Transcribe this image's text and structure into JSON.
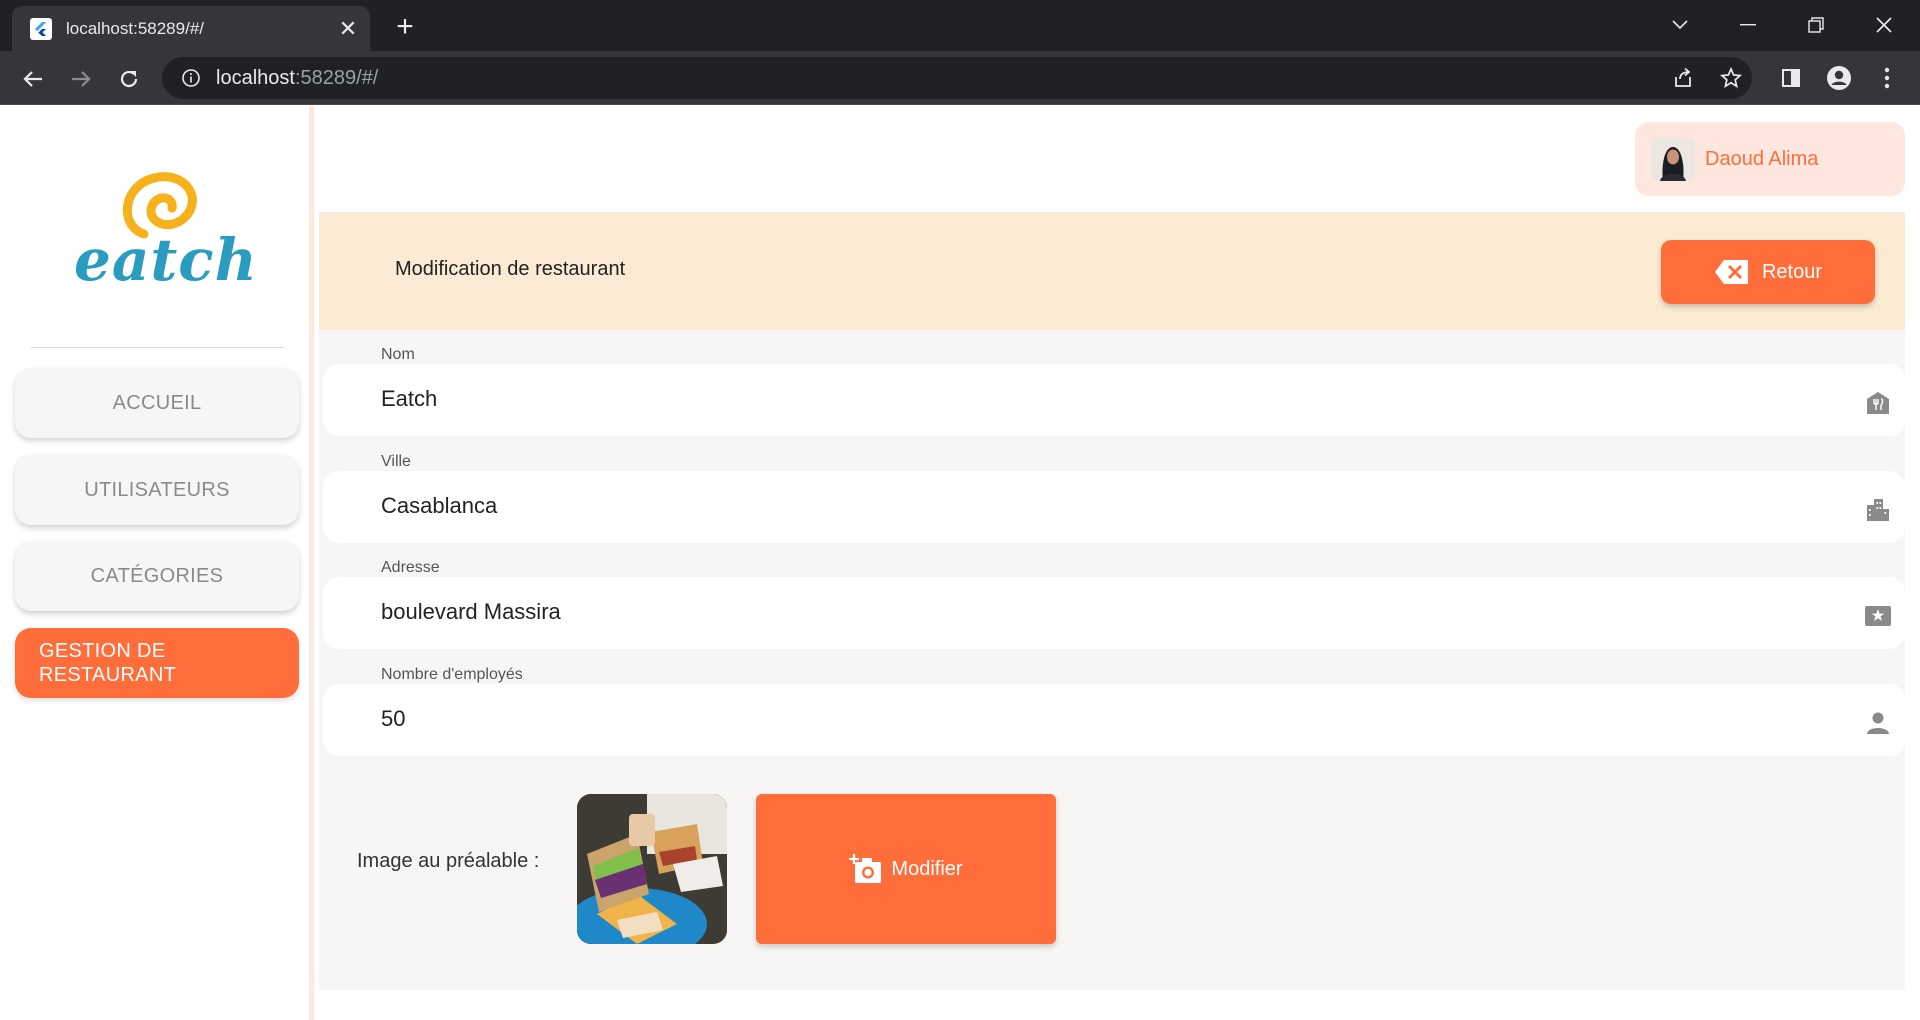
{
  "browser": {
    "tab_title": "localhost:58289/#/",
    "close_glyph": "✕",
    "newtab_glyph": "+",
    "url_host": "localhost",
    "url_rest": ":58289/#/",
    "icons": [
      "flutter-favicon",
      "back-arrow-icon",
      "forward-arrow-icon",
      "reload-icon",
      "info-icon",
      "share-icon",
      "star-icon",
      "sidepanel-icon",
      "profile-icon",
      "more-vert-icon",
      "minimize-icon",
      "restore-icon",
      "close-icon",
      "tab-search-icon"
    ]
  },
  "sidebar": {
    "logo_text": "eatch",
    "items": [
      {
        "label": "ACCUEIL",
        "active": false
      },
      {
        "label": "UTILISATEURS",
        "active": false
      },
      {
        "label": "CATÉGORIES",
        "active": false
      },
      {
        "label": "GESTION DE RESTAURANT",
        "active": true
      }
    ]
  },
  "header": {
    "user_name": "Daoud Alima"
  },
  "banner": {
    "title": "Modification de restaurant",
    "back_label": "Retour"
  },
  "form": {
    "fields": [
      {
        "label": "Nom",
        "value": "Eatch",
        "icon": "restaurant-icon"
      },
      {
        "label": "Ville",
        "value": "Casablanca",
        "icon": "city-icon"
      },
      {
        "label": "Adresse",
        "value": "boulevard Massira",
        "icon": "address-card-icon"
      },
      {
        "label": "Nombre d'employés",
        "value": "50",
        "icon": "person-icon"
      }
    ],
    "image_label": "Image au préalable :",
    "modify_label": "Modifier"
  },
  "colors": {
    "accent": "#ff6d3a",
    "banner_bg": "#fcebd4",
    "chip_bg": "#fde7df",
    "logo_blue": "#2a9cc0",
    "logo_yellow": "#f5b21c"
  }
}
